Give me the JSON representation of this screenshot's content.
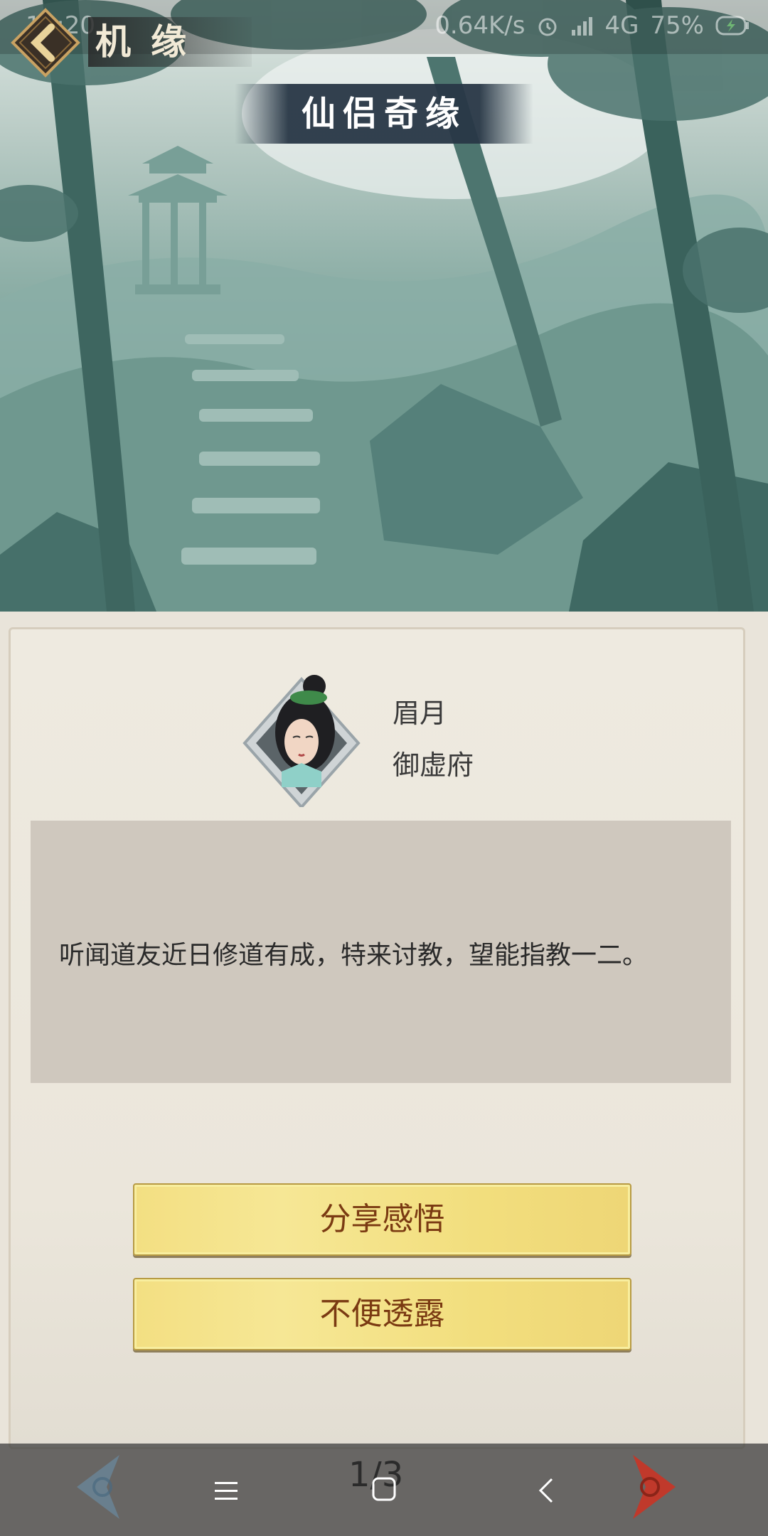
{
  "status_bar": {
    "time": "12:20",
    "network_speed": "0.64K/s",
    "network": "4G",
    "battery": "75%"
  },
  "header": {
    "title": "机缘",
    "banner": "仙侣奇缘"
  },
  "npc": {
    "name": "眉月",
    "sect": "御虚府"
  },
  "dialog": {
    "text": "听闻道友近日修道有成，特来讨教，望能指教一二。"
  },
  "choices": [
    {
      "label": "分享感悟"
    },
    {
      "label": "不便透露"
    }
  ],
  "pager": {
    "indicator": "1/3"
  },
  "colors": {
    "choice_text": "#7a3a12",
    "choice_bg": "#f3df82",
    "dialog_bg": "#cfc8be",
    "next_arrow": "#c0392b",
    "prev_arrow": "#6a8aa0"
  }
}
